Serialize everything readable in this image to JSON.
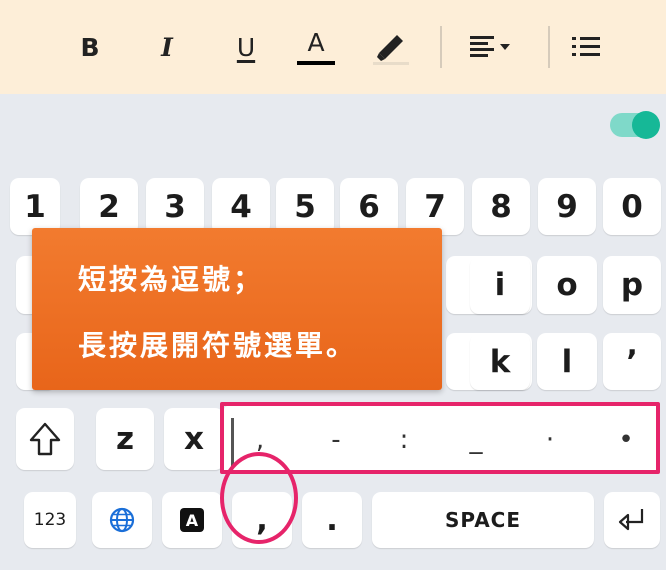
{
  "toolbar": {
    "bold_label": "B",
    "italic_label": "I",
    "underline_label": "U",
    "font_color_label": "A",
    "font_color": "#000000",
    "icons": [
      "bold-icon",
      "italic-icon",
      "underline-icon",
      "font-color-icon",
      "highlighter-icon",
      "align-dropdown-icon",
      "list-icon"
    ]
  },
  "toggle": {
    "state": "on",
    "color": "#16b897"
  },
  "keyboard": {
    "number_row": [
      "1",
      "2",
      "3",
      "4",
      "5",
      "6",
      "7",
      "8",
      "9",
      "0"
    ],
    "row2_visible": [
      "i",
      "o",
      "p"
    ],
    "row3_visible": [
      "k",
      "l",
      "’"
    ],
    "row4": {
      "shift_icon": "shift-icon",
      "keys": [
        "z",
        "x"
      ]
    },
    "row5": {
      "numbers_label": "123",
      "globe_icon": "globe-icon",
      "lang_label": "A",
      "comma_label": ",",
      "period_label": ".",
      "space_label": "SPACE",
      "enter_icon": "enter-icon"
    }
  },
  "popup": {
    "symbols": [
      ",",
      "-",
      ":",
      "_",
      "·",
      "•"
    ]
  },
  "tooltip": {
    "line1": "短按為逗號；",
    "line2": "長按展開符號選單。"
  },
  "colors": {
    "toolbar_bg": "#fdeed8",
    "keyboard_bg": "#e7eaef",
    "tooltip_bg": "#f27b2f",
    "highlight": "#e6246a"
  }
}
